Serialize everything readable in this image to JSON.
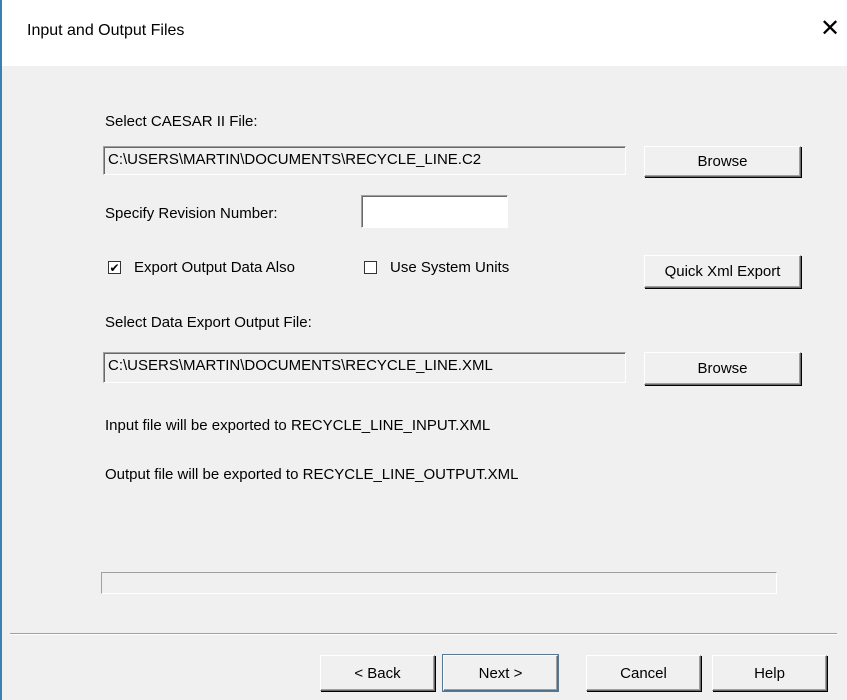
{
  "window": {
    "title": "Input and Output Files",
    "close_glyph": "✕"
  },
  "caesar": {
    "label": "Select CAESAR II File:",
    "value": "C:\\USERS\\MARTIN\\DOCUMENTS\\RECYCLE_LINE.C2",
    "browse_label": "Browse"
  },
  "revision": {
    "label": "Specify Revision Number:",
    "value": ""
  },
  "options": {
    "export_output": {
      "label": "Export Output Data Also",
      "checked": true,
      "mark": "✔"
    },
    "system_units": {
      "label": "Use System Units",
      "checked": false,
      "mark": ""
    },
    "quick_xml_label": "Quick Xml Export"
  },
  "export": {
    "label": "Select Data Export Output File:",
    "value": "C:\\USERS\\MARTIN\\DOCUMENTS\\RECYCLE_LINE.XML",
    "browse_label": "Browse"
  },
  "info": {
    "input_msg": "Input file will be exported to RECYCLE_LINE_INPUT.XML",
    "output_msg": "Output file will be exported to RECYCLE_LINE_OUTPUT.XML"
  },
  "progress": {
    "value": 0
  },
  "footer": {
    "back_label": "< Back",
    "next_label": "Next >",
    "cancel_label": "Cancel",
    "help_label": "Help"
  }
}
